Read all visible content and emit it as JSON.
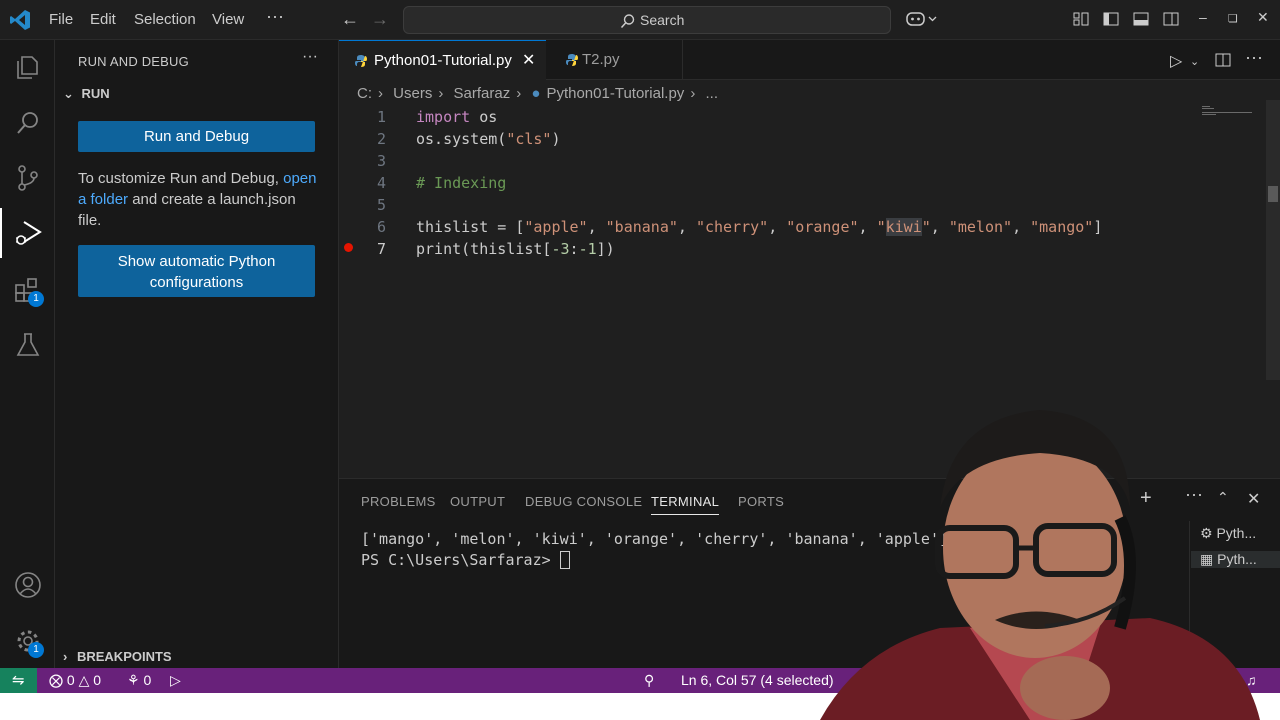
{
  "menu": [
    "File",
    "Edit",
    "Selection",
    "View",
    "···"
  ],
  "search": {
    "label": "Search"
  },
  "sidebar": {
    "title": "RUN AND DEBUG",
    "section": "RUN",
    "run_button": "Run and Debug",
    "customize_text_1": "To customize Run and Debug, ",
    "customize_link": "open a folder",
    "customize_text_2": " and create a launch.json file.",
    "show_config_line1": "Show automatic Python",
    "show_config_line2": "configurations",
    "breakpoints": "BREAKPOINTS"
  },
  "activity_badges": {
    "extensions": "1",
    "settings": "1"
  },
  "tabs": [
    {
      "label": "Python01-Tutorial.py",
      "active": true
    },
    {
      "label": "T2.py",
      "active": false
    }
  ],
  "breadcrumb": [
    "C:",
    "Users",
    "Sarfaraz",
    "Python01-Tutorial.py",
    "..."
  ],
  "code": {
    "line_numbers": [
      "1",
      "2",
      "3",
      "4",
      "5",
      "6",
      "7"
    ],
    "l1_kw": "import",
    "l1_rest": " os",
    "l2_a": "os.system(",
    "l2_str": "\"cls\"",
    "l2_b": ")",
    "l4_comment": "# Indexing",
    "l6_a": "thislist = [",
    "l6_s1": "\"apple\"",
    "l6_s2": "\"banana\"",
    "l6_s3": "\"cherry\"",
    "l6_s4": "\"orange\"",
    "l6_q": "\"",
    "l6_sel": "kiwi",
    "l6_s6": "\"melon\"",
    "l6_s7": "\"mango\"",
    "l6_end": "]",
    "l7_a": "print(thislist[",
    "l7_n1": "-3",
    "l7_colon": ":",
    "l7_n2": "-1",
    "l7_b": "])",
    "sep": ", "
  },
  "panel": {
    "tabs": [
      "PROBLEMS",
      "OUTPUT",
      "DEBUG CONSOLE",
      "TERMINAL",
      "PORTS"
    ],
    "active_tab": "TERMINAL",
    "output_line": "['mango', 'melon', 'kiwi', 'orange', 'cherry', 'banana', 'apple']",
    "prompt": "PS C:\\Users\\Sarfaraz> ",
    "terminals": [
      "Pyth...",
      "Pyth..."
    ]
  },
  "status": {
    "errors": "0",
    "warnings": "0",
    "ports": "0",
    "position": "Ln 6, Col 57 (4 selected)"
  },
  "colors": {
    "status_bar": "#68217a",
    "remote": "#16825d",
    "accent": "#0078d4",
    "button": "#0e639c"
  }
}
